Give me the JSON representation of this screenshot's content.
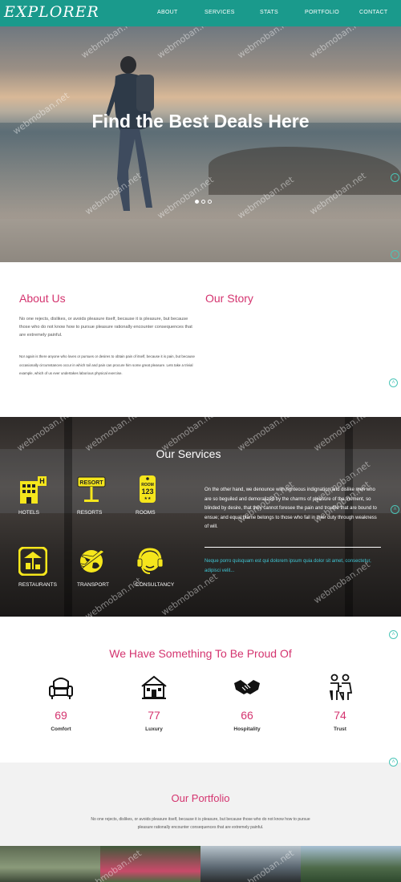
{
  "header": {
    "logo": "EXPLORER",
    "nav": [
      "ABOUT",
      "SERVICES",
      "STATS",
      "PORTFOLIO",
      "CONTACT"
    ]
  },
  "hero": {
    "headline": "Find the Best Deals Here",
    "slides_total": 3,
    "active_slide": 1
  },
  "about": {
    "title": "About Us",
    "paragraph1": "No one rejects, dislikes, or avoids pleasure itself, because it is pleasure, but because those who do not know how to pursue pleasure rationally encounter consequences that are extremely painful.",
    "paragraph2": "Nor again is there anyone who loves or pursues or desires to obtain pain of itself, because it is pain, but because occasionally circumstances occur in which toil and pain can procure him some great pleasure. Lets take a trivial example, which of us ever undertakes laborious physical exercise.",
    "story_title": "Our Story"
  },
  "services": {
    "title": "Our Services",
    "items": [
      {
        "label": "HOTELS",
        "icon": "hotel-icon"
      },
      {
        "label": "RESORTS",
        "icon": "resort-sign-icon"
      },
      {
        "label": "ROOMS",
        "icon": "room-key-icon"
      },
      {
        "label": "RESTAURANTS",
        "icon": "restaurant-icon"
      },
      {
        "label": "TRANSPORT",
        "icon": "globe-plane-icon"
      },
      {
        "label": "CONSULTANCY",
        "icon": "headset-icon"
      }
    ],
    "sign_resort": "RESORT",
    "key_room": "ROOM",
    "key_number": "123",
    "text": "On the other hand, we denounce with righteous indignation and dislike men who are so beguiled and demoralized by the charms of pleasure of the moment, so blinded by desire, that they cannot foresee the pain and trouble that are bound to ensue; and equal blame belongs to those who fail in their duty through weakness of will.",
    "quote": "Neque porro quisquam est qui dolorem ipsum quia dolor sit amet, consectetur, adipisci velit..."
  },
  "stats": {
    "title": "We Have Something To Be Proud Of",
    "items": [
      {
        "value": 69,
        "label": "Comfort",
        "icon": "armchair-icon"
      },
      {
        "value": 77,
        "label": "Luxury",
        "icon": "house-icon"
      },
      {
        "value": 66,
        "label": "Hospitality",
        "icon": "handshake-icon"
      },
      {
        "value": 74,
        "label": "Trust",
        "icon": "couple-icon"
      }
    ]
  },
  "portfolio": {
    "title": "Our Portfolio",
    "text": "No one rejects, dislikes, or avoids pleasure itself, because it is pleasure, but because those who do not know how to pursue pleasure rationally encounter consequences that are extremely painful."
  },
  "watermark": "webmoban.net",
  "colors": {
    "nav_bg": "#1a9a8c",
    "accent_pink": "#d4346f",
    "icon_yellow": "#f5e61c",
    "quote_cyan": "#3fc7d6",
    "arrow_teal": "#4bc5b7"
  }
}
